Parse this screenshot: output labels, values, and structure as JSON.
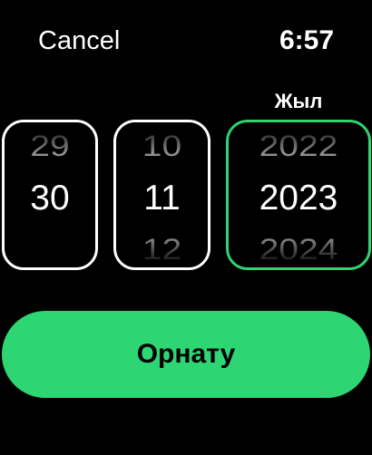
{
  "header": {
    "cancel_label": "Cancel",
    "time": "6:57"
  },
  "picker": {
    "active_column_label": "Жыл",
    "columns": [
      {
        "prev": "29",
        "current": "30",
        "next": ""
      },
      {
        "prev": "10",
        "current": "11",
        "next": "12"
      },
      {
        "prev": "2022",
        "current": "2023",
        "next": "2024"
      }
    ]
  },
  "action": {
    "set_label": "Орнату"
  },
  "colors": {
    "accent": "#2ed573",
    "background": "#000000",
    "text": "#ffffff"
  }
}
